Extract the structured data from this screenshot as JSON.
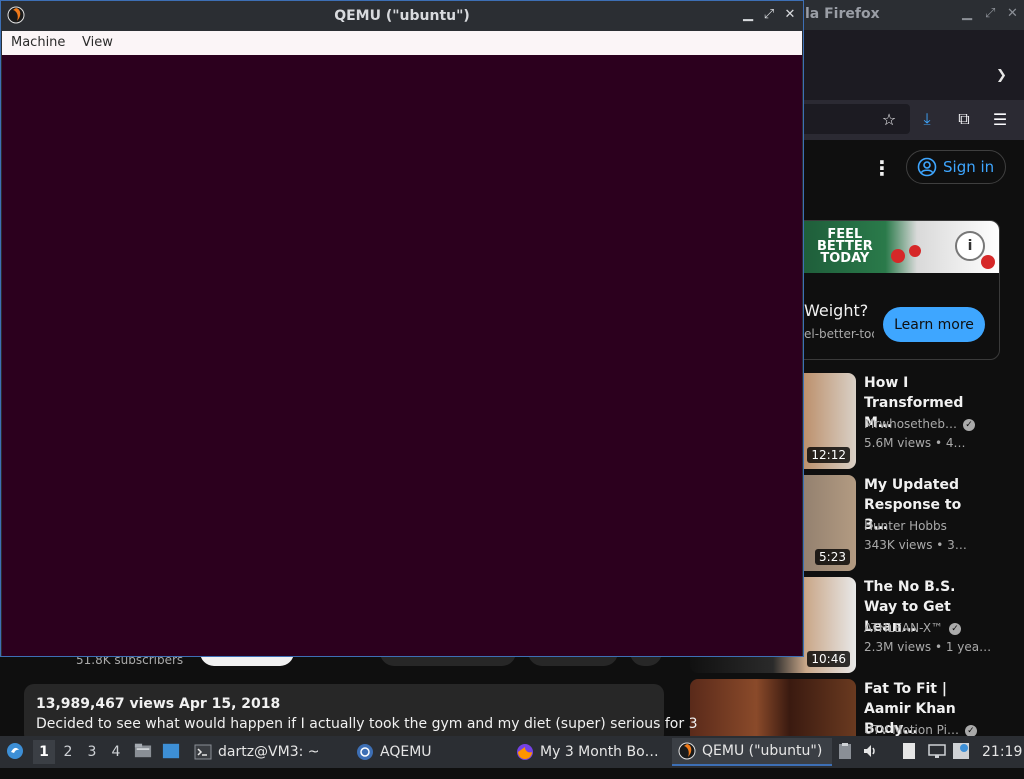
{
  "firefox": {
    "title_fragment": "la Firefox",
    "sign_in_label": "Sign in",
    "ad": {
      "banner_text": "FEEL\nBETTER\nTODAY",
      "title": "Weight?",
      "url": "el-better-toda",
      "button": "Learn more"
    },
    "recommendations": [
      {
        "title": "How I Transformed M…",
        "channel": "Mrwhosetheb…",
        "meta": "5.6M views  • 4…",
        "duration": "12:12",
        "verified": true
      },
      {
        "title": "My Updated Response to 3…",
        "channel": "Hunter Hobbs",
        "meta": "343K views  • 3…",
        "duration": "5:23",
        "verified": false
      },
      {
        "title": "The No B.S. Way to Get Lean…",
        "channel": "ATHLEAN-X™",
        "meta": "2.3M views  • 1 yea…",
        "duration": "10:46",
        "verified": true
      },
      {
        "title": "Fat To Fit | Aamir Khan Body…",
        "channel": "UTV Motion Pi…",
        "meta": "",
        "duration": "",
        "verified": true
      }
    ],
    "video": {
      "subscribers": "51.8K subscribers",
      "views_date": "13,989,467 views  Apr 15, 2018",
      "description": "Decided to see what would happen if I actually took the gym and my diet (super) serious for 3"
    }
  },
  "qemu": {
    "title": "QEMU (\"ubuntu\")",
    "menu": [
      "Machine",
      "View"
    ],
    "controls": {
      "minimize": "▁",
      "maximize": "⤢",
      "close": "✕"
    }
  },
  "taskbar": {
    "workspaces": [
      "1",
      "2",
      "3",
      "4"
    ],
    "active_workspace": "1",
    "tasks": [
      {
        "label": "dartz@VM3: ~",
        "icon": "terminal-icon"
      },
      {
        "label": "AQEMU",
        "icon": "aqemu-icon"
      },
      {
        "label": "My 3 Month Bo…",
        "icon": "firefox-icon"
      },
      {
        "label": "QEMU (\"ubuntu\")",
        "icon": "qemu-icon"
      }
    ],
    "clock": "21:19"
  }
}
